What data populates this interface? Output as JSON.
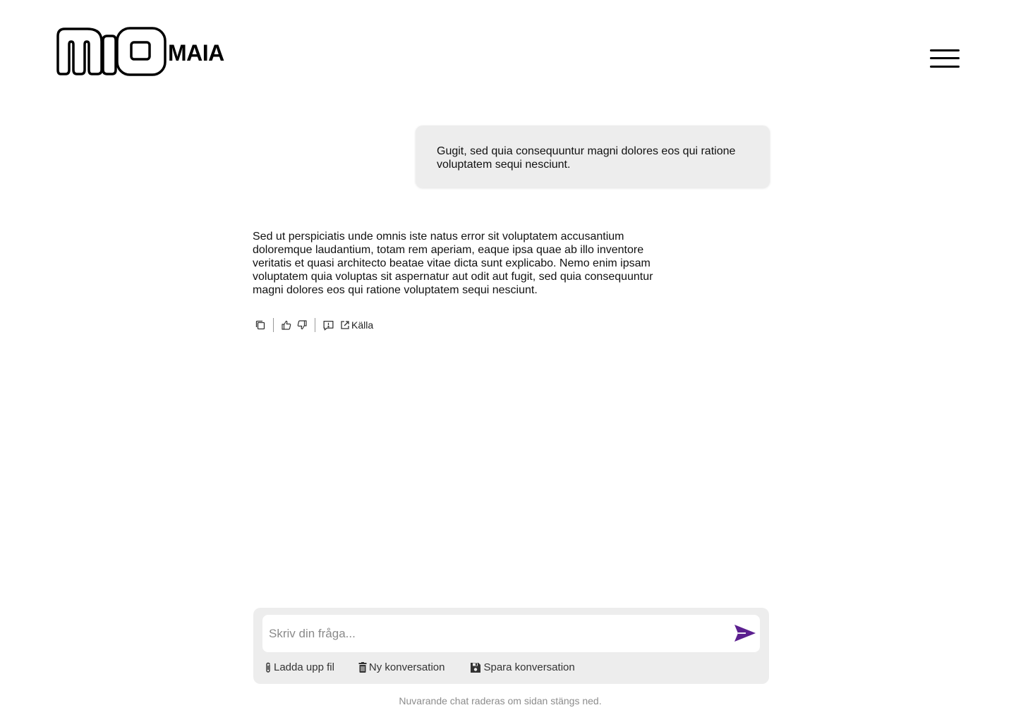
{
  "header": {
    "logo_text": "MAIA",
    "logo_icon": "mio-logo-icon",
    "menu_icon": "hamburger-menu-icon"
  },
  "conversation": {
    "user_message": "Gugit, sed quia consequuntur magni dolores eos qui ratione voluptatem sequi nesciunt.",
    "assistant_message": "Sed ut perspiciatis unde omnis iste natus error sit voluptatem accusantium doloremque laudantium, totam rem aperiam, eaque ipsa quae ab illo inventore veritatis et quasi architecto beatae vitae dicta sunt explicabo. Nemo enim ipsam voluptatem quia voluptas sit aspernatur aut odit aut fugit, sed quia consequuntur magni dolores eos qui ratione voluptatem sequi nesciunt.",
    "actions": {
      "copy_icon": "copy-icon",
      "thumbs_up_icon": "thumbs-up-icon",
      "thumbs_down_icon": "thumbs-down-icon",
      "report_icon": "report-icon",
      "source_icon": "external-link-icon",
      "source_label": "Källa"
    }
  },
  "composer": {
    "placeholder": "Skriv din fråga...",
    "value": "",
    "send_icon": "send-icon",
    "upload_label": "Ladda upp fil",
    "upload_icon": "paperclip-icon",
    "new_label": "Ny konversation",
    "new_icon": "trash-icon",
    "save_label": "Spara konversation",
    "save_icon": "floppy-disk-icon"
  },
  "footer": {
    "note": "Nuvarande chat raderas om sidan stängs ned."
  },
  "colors": {
    "accent": "#5b1f8f",
    "bubble_bg": "#ededed",
    "composer_bg": "#ededed"
  }
}
